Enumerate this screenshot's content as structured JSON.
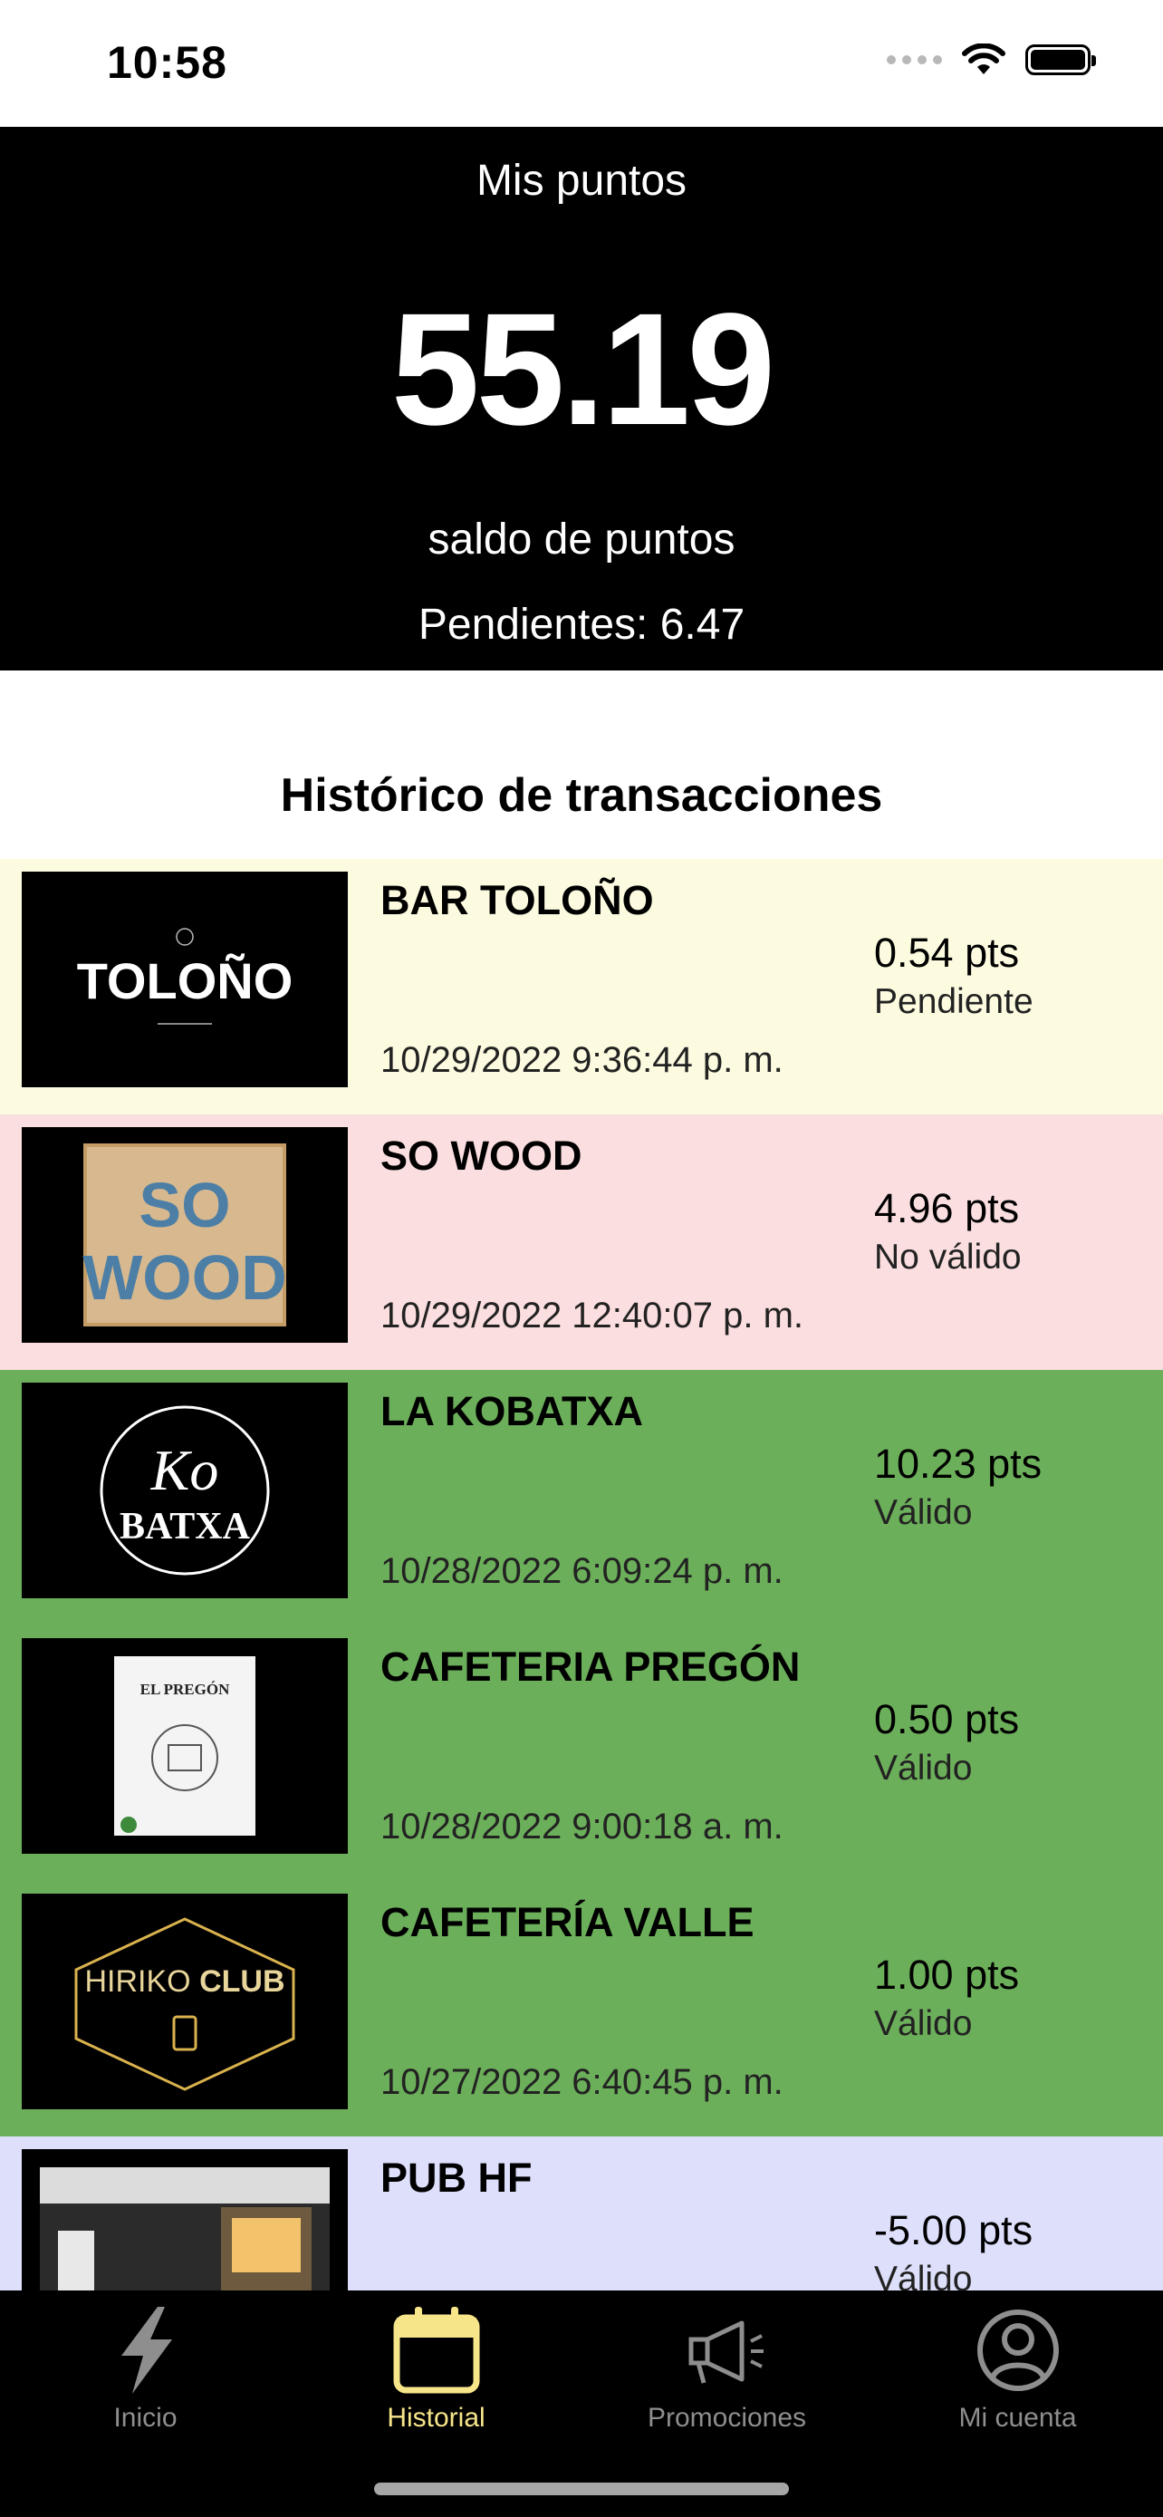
{
  "status_bar": {
    "time": "10:58"
  },
  "points": {
    "title": "Mis puntos",
    "value": "55.19",
    "caption": "saldo de puntos",
    "pending": "Pendientes: 6.47"
  },
  "history": {
    "title": "Histórico de transacciones",
    "transactions": [
      {
        "name": "BAR TOLOÑO",
        "date": "10/29/2022 9:36:44 p. m.",
        "amount": "0.54 pts",
        "status": "Pendiente",
        "bg": "#fcfbe0",
        "logo_text": "TOLOÑO"
      },
      {
        "name": "SO WOOD",
        "date": "10/29/2022 12:40:07 p. m.",
        "amount": "4.96 pts",
        "status": "No válido",
        "bg": "#fbdedf",
        "logo_text": "SO WOOD"
      },
      {
        "name": "LA KOBATXA",
        "date": "10/28/2022 6:09:24 p. m.",
        "amount": "10.23 pts",
        "status": "Válido",
        "bg": "#6caf5a",
        "logo_text": "KO BATXA"
      },
      {
        "name": "CAFETERIA PREGÓN",
        "date": "10/28/2022 9:00:18 a. m.",
        "amount": "0.50 pts",
        "status": "Válido",
        "bg": "#6caf5a",
        "logo_text": "EL PREGÓN"
      },
      {
        "name": "CAFETERÍA VALLE",
        "date": "10/27/2022 6:40:45 p. m.",
        "amount": "1.00 pts",
        "status": "Válido",
        "bg": "#6caf5a",
        "logo_text": "HIRIKO CLUB"
      },
      {
        "name": "PUB HF",
        "date": "",
        "amount": "-5.00 pts",
        "status": "Válido",
        "bg": "#dddffb",
        "logo_text": ""
      }
    ]
  },
  "tabs": [
    {
      "label": "Inicio",
      "icon": "bolt-icon",
      "active": false
    },
    {
      "label": "Historial",
      "icon": "calendar-icon",
      "active": true
    },
    {
      "label": "Promociones",
      "icon": "megaphone-icon",
      "active": false
    },
    {
      "label": "Mi cuenta",
      "icon": "account-icon",
      "active": false
    }
  ],
  "colors": {
    "pending_row": "#fcfbe0",
    "invalid_row": "#fbdedf",
    "valid_row": "#6caf5a",
    "refund_row": "#dddffb",
    "tab_active": "#f7e58a",
    "tab_inactive": "#8e8e8e"
  }
}
